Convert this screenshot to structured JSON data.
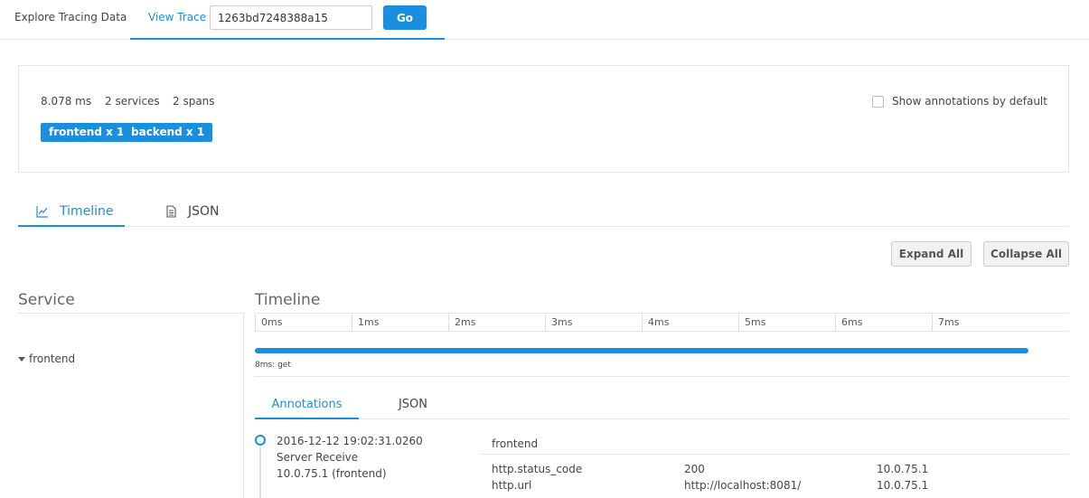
{
  "nav": {
    "explore_label": "Explore Tracing Data",
    "view_trace_label": "View Trace",
    "trace_id_value": "1263bd7248388a15",
    "go_label": "Go"
  },
  "summary": {
    "duration": "8.078 ms",
    "services": "2 services",
    "spans": "2 spans",
    "service_tags": [
      "frontend x 1",
      "backend x 1"
    ],
    "show_annotations_label": "Show annotations by default"
  },
  "tabs": {
    "timeline_label": "Timeline",
    "json_label": "JSON"
  },
  "actions": {
    "expand_all": "Expand All",
    "collapse_all": "Collapse All"
  },
  "columns": {
    "service": "Service",
    "timeline": "Timeline"
  },
  "ticks": [
    "0ms",
    "1ms",
    "2ms",
    "3ms",
    "4ms",
    "5ms",
    "6ms",
    "7ms"
  ],
  "span": {
    "service_name": "frontend",
    "label": "8ms: get",
    "start_ms": 0,
    "duration_ms": 8.078
  },
  "detail_tabs": {
    "annotations_label": "Annotations",
    "json_label": "JSON"
  },
  "annotation": {
    "timestamp": "2016-12-12 19:02:31.0260",
    "kind": "Server Receive",
    "endpoint": "10.0.75.1 (frontend)",
    "service": "frontend"
  },
  "tags": [
    {
      "key": "http.status_code",
      "value": "200",
      "endpoint": "10.0.75.1"
    },
    {
      "key": "http.url",
      "value": "http://localhost:8081/",
      "endpoint": "10.0.75.1"
    }
  ],
  "colors": {
    "accent": "#1a8fdd"
  }
}
